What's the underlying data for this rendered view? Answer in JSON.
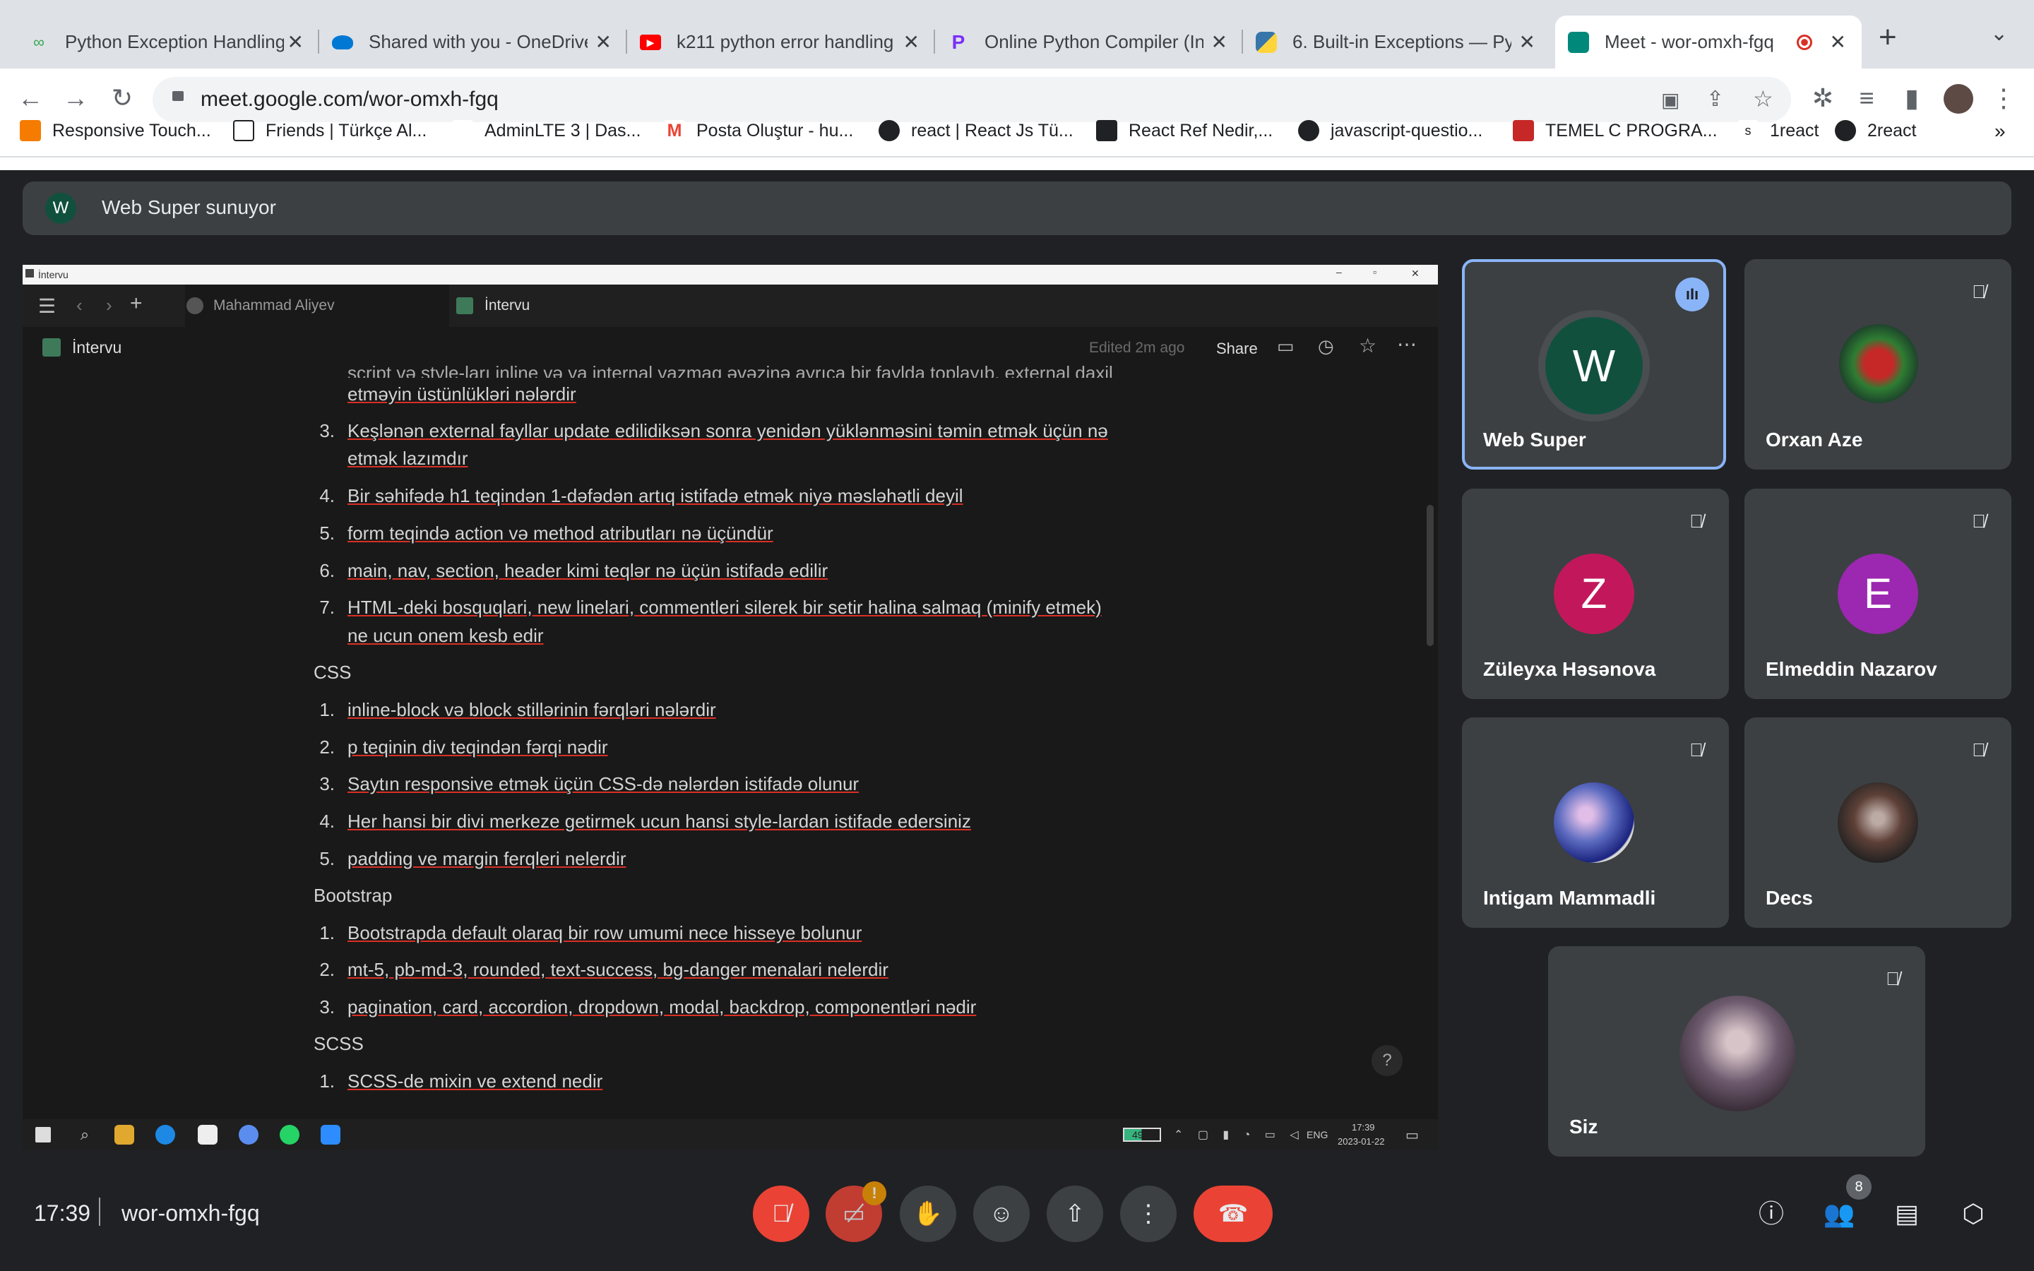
{
  "browser": {
    "tabs": [
      {
        "label": "Python Exception Handling",
        "color": "#34a853"
      },
      {
        "label": "Shared with you - OneDrive",
        "color": "#0078d4"
      },
      {
        "label": "k211 python error handling",
        "color": "#ff0000"
      },
      {
        "label": "Online Python Compiler (Int",
        "color": "#7b2ff7"
      },
      {
        "label": "6. Built-in Exceptions — Py",
        "color": "#3776ab"
      },
      {
        "label": "Meet - wor-omxh-fgq",
        "color": "#00897b"
      }
    ],
    "url": "meet.google.com/wor-omxh-fgq",
    "bookmarks": [
      {
        "label": "Responsive Touch...",
        "color": "#f57c00"
      },
      {
        "label": "Friends | Türkçe Al...",
        "color": "#202124"
      },
      {
        "label": "AdminLTE 3 | Das...",
        "color": "#ffffff"
      },
      {
        "label": "Posta Oluştur - hu...",
        "color": "#ea4335"
      },
      {
        "label": "react | React Js Tü...",
        "color": "#202124"
      },
      {
        "label": "React Ref Nedir,...",
        "color": "#202124"
      },
      {
        "label": "javascript-questio...",
        "color": "#202124"
      },
      {
        "label": "TEMEL C PROGRA...",
        "color": "#c62828"
      },
      {
        "label": "1react",
        "color": "#ffffff"
      },
      {
        "label": "2react",
        "color": "#202124"
      }
    ]
  },
  "meet": {
    "presenter_initial": "W",
    "presenting_text": "Web Super sunuyor",
    "time": "17:39",
    "meeting_code": "wor-omxh-fgq",
    "people_count": "8",
    "participants": [
      {
        "name": "Web Super",
        "initial": "W",
        "color": "#12503e",
        "speaking": true
      },
      {
        "name": "Orxan Aze",
        "initial": "",
        "color": "#1b3a2a"
      },
      {
        "name": "Züleyxa Həsənova",
        "initial": "Z",
        "color": "#c2185b"
      },
      {
        "name": "Elmeddin Nazarov",
        "initial": "E",
        "color": "#9c27b0"
      },
      {
        "name": "Intigam Mammadli",
        "initial": "",
        "color": "#5c6bc0"
      },
      {
        "name": "Decs",
        "initial": "",
        "color": "#5d4037"
      },
      {
        "name": "Siz",
        "initial": "",
        "color": "#6d5a6e"
      }
    ]
  },
  "shared": {
    "window_title": "İntervu",
    "tab_user": "Mahammad Aliyev",
    "tab_page": "İntervu",
    "page_title": "İntervu",
    "edited": "Edited 2m ago",
    "share": "Share",
    "taskbar_battery": "49%",
    "taskbar_lang": "ENG",
    "taskbar_time": "17:39",
    "taskbar_date": "2023-01-22",
    "cut_line_1": "script və style-ları inline və ya internal yazmaq əvəzinə ayrıca bir faylda toplayıb, external daxil",
    "cut_line_2": "etməyin üstünlükləri nələrdir",
    "html_items": [
      {
        "n": "3.",
        "t": "Keşlənən external fayllar update edilidiksən sonra yenidən yüklənməsini təmin etmək üçün nə",
        "t2": "etmək lazımdır"
      },
      {
        "n": "4.",
        "t": "Bir səhifədə h1 teqindən 1-dəfədən artıq istifadə etmək niyə məsləhətli deyil"
      },
      {
        "n": "5.",
        "t": "form teqində action və method atributları nə üçündür"
      },
      {
        "n": "6.",
        "t": "main, nav, section, header kimi teqlər nə üçün istifadə edilir"
      },
      {
        "n": "7.",
        "t": "HTML-deki bosquqlari, new linelari, commentleri silerek bir setir halina salmaq (minify etmek)",
        "t2": "ne ucun onem kesb edir"
      }
    ],
    "css_heading": "CSS",
    "css_items": [
      {
        "n": "1.",
        "t": "inline-block və block stillərinin fərqləri nələrdir"
      },
      {
        "n": "2.",
        "t": "p teqinin div teqindən fərqi nədir"
      },
      {
        "n": "3.",
        "t": "Saytın responsive etmək üçün CSS-də nələrdən istifadə olunur"
      },
      {
        "n": "4.",
        "t": "Her hansi bir divi merkeze getirmek ucun hansi style-lardan istifade edersiniz"
      },
      {
        "n": "5.",
        "t": "padding ve margin ferqleri nelerdir"
      }
    ],
    "bootstrap_heading": "Bootstrap",
    "bootstrap_items": [
      {
        "n": "1.",
        "t": "Bootstrapda default olaraq bir row umumi nece hisseye bolunur"
      },
      {
        "n": "2.",
        "t": "mt-5, pb-md-3, rounded, text-success, bg-danger menalari nelerdir"
      },
      {
        "n": "3.",
        "t": "pagination, card, accordion, dropdown, modal, backdrop, componentləri nədir"
      }
    ],
    "scss_heading": "SCSS",
    "scss_items": [
      {
        "n": "1.",
        "t": "SCSS-de mixin ve extend nedir"
      }
    ]
  }
}
